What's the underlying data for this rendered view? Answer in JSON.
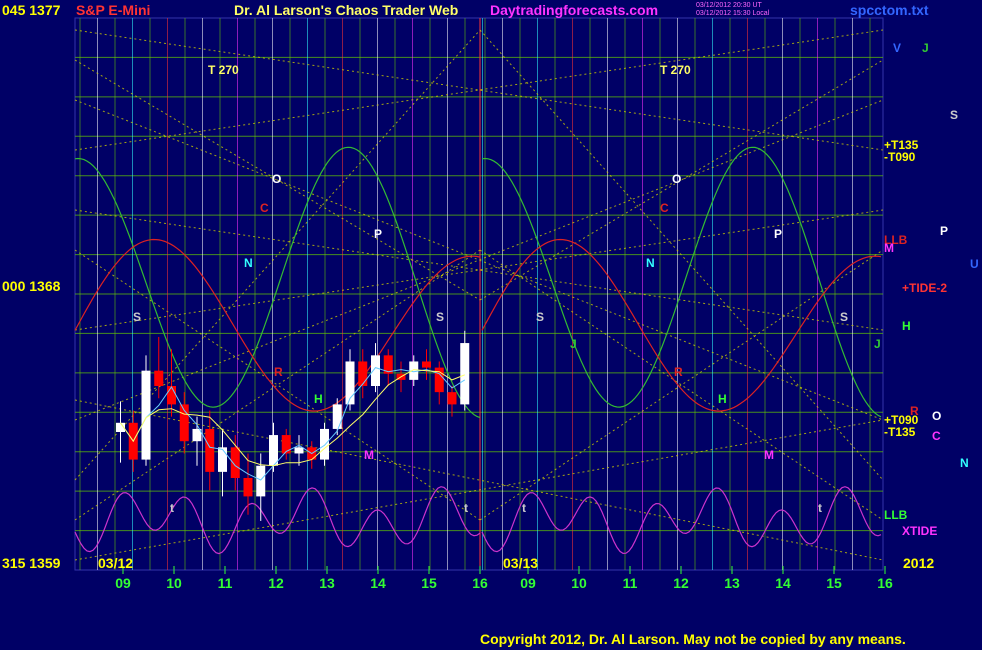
{
  "header": {
    "instrument": "S&P E-Mini",
    "title": "Dr. Al Larson's Chaos Trader Web",
    "site": "Daytradingforecasts.com",
    "stamp1": "03/12/2012 20:30 UT",
    "stamp2": "03/12/2012 15:30 Local",
    "file": "spcctom.txt"
  },
  "y_axis": {
    "top": "045  1377",
    "mid": "000  1368",
    "bottom": "315  1359"
  },
  "dates": [
    "03/12",
    "03/13"
  ],
  "year": "2012",
  "hours": [
    "09",
    "10",
    "11",
    "12",
    "13",
    "14",
    "15",
    "16",
    "09",
    "10",
    "11",
    "12",
    "13",
    "14",
    "15",
    "16"
  ],
  "copyright": "Copyright 2012, Dr. Al Larson. May not be copied by any means.",
  "colors": {
    "background": "#000066",
    "grid_green": "#66cc00",
    "diag_yellow": "#cccc00",
    "axis_yellow": "#ffff00",
    "hour_green": "#33ff33",
    "price_up": "#ffffff",
    "price_down": "#ff0000",
    "ma_cyan": "#66ccff",
    "ma_yellow": "#ffff66",
    "tide_green": "#33bb33",
    "tide_red": "#dd2222",
    "xtide_magenta": "#cc33cc"
  },
  "chart_data": {
    "type": "line",
    "title": "S&P E-Mini",
    "y_range": [
      1359,
      1377
    ],
    "y_ticks": [
      {
        "angle": "045",
        "price": 1377
      },
      {
        "angle": "000",
        "price": 1368
      },
      {
        "angle": "315",
        "price": 1359
      }
    ],
    "x_days": [
      "03/12",
      "03/13"
    ],
    "x_hours": [
      9,
      10,
      11,
      12,
      13,
      14,
      15,
      16
    ],
    "right_labels": [
      {
        "text": "V",
        "color": "#3366ff"
      },
      {
        "text": "J",
        "color": "#33cc33"
      },
      {
        "text": "S",
        "color": "#cccccc"
      },
      {
        "text": "+T135",
        "color": "#ffff00"
      },
      {
        "text": "-T090",
        "color": "#ffff00"
      },
      {
        "text": "LLB",
        "color": "#dd2222"
      },
      {
        "text": "M",
        "color": "#ff33ff"
      },
      {
        "text": "P",
        "color": "#ffffff"
      },
      {
        "text": "U",
        "color": "#3366ff"
      },
      {
        "text": "+TIDE-2",
        "color": "#ff3333"
      },
      {
        "text": "H",
        "color": "#33ff33"
      },
      {
        "text": "J",
        "color": "#33cc33"
      },
      {
        "text": "+T090",
        "color": "#ffff00"
      },
      {
        "text": "O",
        "color": "#ffffff"
      },
      {
        "text": "R",
        "color": "#dd2222"
      },
      {
        "text": "-T135",
        "color": "#ffff00"
      },
      {
        "text": "C",
        "color": "#ff33ff"
      },
      {
        "text": "N",
        "color": "#33ffff"
      },
      {
        "text": "LLB",
        "color": "#33ff33"
      },
      {
        "text": "XTIDE",
        "color": "#ff33ff"
      }
    ],
    "in_chart_labels": [
      {
        "text": "T  270",
        "color": "#ffff66"
      },
      {
        "text": "T  270",
        "color": "#ffff66"
      },
      {
        "text": "O",
        "color": "#ffffff"
      },
      {
        "text": "O",
        "color": "#ffffff"
      },
      {
        "text": "C",
        "color": "#dd2222"
      },
      {
        "text": "C",
        "color": "#dd2222"
      },
      {
        "text": "P",
        "color": "#ffffff"
      },
      {
        "text": "P",
        "color": "#ffffff"
      },
      {
        "text": "N",
        "color": "#33ffff"
      },
      {
        "text": "N",
        "color": "#33ffff"
      },
      {
        "text": "S",
        "color": "#cccccc"
      },
      {
        "text": "S",
        "color": "#cccccc"
      },
      {
        "text": "S",
        "color": "#cccccc"
      },
      {
        "text": "S",
        "color": "#cccccc"
      },
      {
        "text": "R",
        "color": "#dd2222"
      },
      {
        "text": "R",
        "color": "#dd2222"
      },
      {
        "text": "H",
        "color": "#33ff33"
      },
      {
        "text": "H",
        "color": "#33ff33"
      },
      {
        "text": "M",
        "color": "#ff33ff"
      },
      {
        "text": "M",
        "color": "#ff33ff"
      },
      {
        "text": "J",
        "color": "#33cc33"
      },
      {
        "text": "t",
        "color": "#cccccc"
      },
      {
        "text": "t",
        "color": "#cccccc"
      },
      {
        "text": "t",
        "color": "#cccccc"
      },
      {
        "text": "t",
        "color": "#cccccc"
      }
    ],
    "price_bars": [
      {
        "h": 9.0,
        "o": 1363.5,
        "hi": 1364.5,
        "lo": 1362.5,
        "c": 1363.8
      },
      {
        "h": 9.25,
        "o": 1363.8,
        "hi": 1364.2,
        "lo": 1362.2,
        "c": 1362.6
      },
      {
        "h": 9.5,
        "o": 1362.6,
        "hi": 1366.0,
        "lo": 1362.4,
        "c": 1365.5
      },
      {
        "h": 9.75,
        "o": 1365.5,
        "hi": 1366.6,
        "lo": 1364.6,
        "c": 1365.0
      },
      {
        "h": 10.0,
        "o": 1365.0,
        "hi": 1366.2,
        "lo": 1364.0,
        "c": 1364.4
      },
      {
        "h": 10.25,
        "o": 1364.4,
        "hi": 1364.8,
        "lo": 1362.8,
        "c": 1363.2
      },
      {
        "h": 10.5,
        "o": 1363.2,
        "hi": 1364.0,
        "lo": 1362.4,
        "c": 1363.6
      },
      {
        "h": 10.75,
        "o": 1363.6,
        "hi": 1364.2,
        "lo": 1361.6,
        "c": 1362.2
      },
      {
        "h": 11.0,
        "o": 1362.2,
        "hi": 1363.6,
        "lo": 1361.4,
        "c": 1363.0
      },
      {
        "h": 11.25,
        "o": 1363.0,
        "hi": 1363.4,
        "lo": 1361.6,
        "c": 1362.0
      },
      {
        "h": 11.5,
        "o": 1362.0,
        "hi": 1362.8,
        "lo": 1360.8,
        "c": 1361.4
      },
      {
        "h": 11.75,
        "o": 1361.4,
        "hi": 1362.8,
        "lo": 1360.6,
        "c": 1362.4
      },
      {
        "h": 12.0,
        "o": 1362.4,
        "hi": 1363.8,
        "lo": 1362.2,
        "c": 1363.4
      },
      {
        "h": 12.25,
        "o": 1363.4,
        "hi": 1363.6,
        "lo": 1362.6,
        "c": 1362.8
      },
      {
        "h": 12.5,
        "o": 1362.8,
        "hi": 1363.4,
        "lo": 1362.4,
        "c": 1363.0
      },
      {
        "h": 12.75,
        "o": 1363.0,
        "hi": 1363.2,
        "lo": 1362.3,
        "c": 1362.6
      },
      {
        "h": 13.0,
        "o": 1362.6,
        "hi": 1363.8,
        "lo": 1362.4,
        "c": 1363.6
      },
      {
        "h": 13.25,
        "o": 1363.6,
        "hi": 1364.6,
        "lo": 1363.4,
        "c": 1364.4
      },
      {
        "h": 13.5,
        "o": 1364.4,
        "hi": 1366.2,
        "lo": 1364.2,
        "c": 1365.8
      },
      {
        "h": 13.75,
        "o": 1365.8,
        "hi": 1366.2,
        "lo": 1364.6,
        "c": 1365.0
      },
      {
        "h": 14.0,
        "o": 1365.0,
        "hi": 1366.4,
        "lo": 1364.8,
        "c": 1366.0
      },
      {
        "h": 14.25,
        "o": 1366.0,
        "hi": 1366.2,
        "lo": 1365.0,
        "c": 1365.4
      },
      {
        "h": 14.5,
        "o": 1365.4,
        "hi": 1365.8,
        "lo": 1364.8,
        "c": 1365.2
      },
      {
        "h": 14.75,
        "o": 1365.2,
        "hi": 1366.0,
        "lo": 1365.0,
        "c": 1365.8
      },
      {
        "h": 15.0,
        "o": 1365.8,
        "hi": 1366.2,
        "lo": 1365.2,
        "c": 1365.6
      },
      {
        "h": 15.25,
        "o": 1365.6,
        "hi": 1365.8,
        "lo": 1364.4,
        "c": 1364.8
      },
      {
        "h": 15.5,
        "o": 1364.8,
        "hi": 1365.0,
        "lo": 1364.0,
        "c": 1364.4
      },
      {
        "h": 15.75,
        "o": 1364.4,
        "hi": 1366.8,
        "lo": 1364.2,
        "c": 1366.4
      }
    ]
  }
}
